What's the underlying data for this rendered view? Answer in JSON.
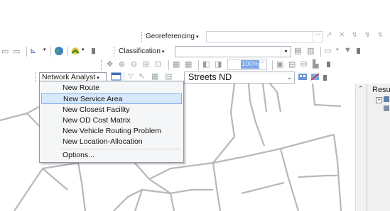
{
  "toolbars": {
    "georeferencing": {
      "label": "Georeferencing"
    },
    "classification": {
      "label": "Classification"
    },
    "zoom_value": "100%",
    "network_analyst": {
      "label": "Network Analyst"
    },
    "network_dataset": "Streets ND"
  },
  "menu": {
    "items": [
      {
        "label": "New Route",
        "selected": false
      },
      {
        "label": "New Service Area",
        "selected": true
      },
      {
        "label": "New Closest Facility",
        "selected": false
      },
      {
        "label": "New OD Cost Matrix",
        "selected": false
      },
      {
        "label": "New Vehicle Routing Problem",
        "selected": false
      },
      {
        "label": "New Location-Allocation",
        "selected": false
      },
      {
        "label": "Options...",
        "selected": false
      }
    ]
  },
  "results_panel": {
    "title": "Resu"
  },
  "colors": {
    "selection_bg": "#d7e8fb",
    "selection_border": "#7fb2e8",
    "road": "#b8b8b8"
  }
}
